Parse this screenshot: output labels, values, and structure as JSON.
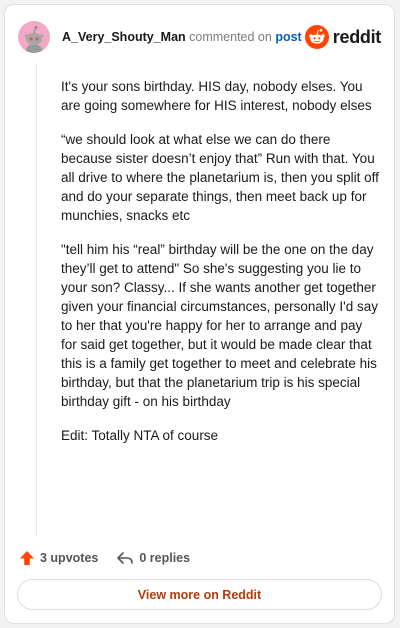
{
  "comment": {
    "username": "A_Very_Shouty_Man",
    "action_text": "commented on",
    "post_link": "post",
    "paragraphs": [
      "It's your sons birthday. HIS day, nobody elses. You are going somewhere for HIS interest, nobody elses",
      "“we should look at what else we can do there because sister doesn’t enjoy that” Run with that. You all drive to where the planetarium is, then you split off and do your separate things, then meet back up for munchies, snacks etc",
      "\"tell him his “real” birthday will be the one on the day they’ll get to attend\" So she's suggesting you lie to your son? Classy... If she wants another get together given your financial circumstances, personally I'd say to her that you're happy for her to arrange and pay for said get together, but it would be made clear that this is a family get together to meet and celebrate his birthday, but that the planetarium trip is his special birthday gift - on his birthday",
      "Edit: Totally NTA of course"
    ],
    "upvotes_label": "3 upvotes",
    "replies_label": "0 replies"
  },
  "brand": {
    "wordmark": "reddit",
    "icon": "reddit-logo-icon",
    "color": "#ff4500"
  },
  "footer": {
    "view_more_label": "View more on Reddit"
  },
  "colors": {
    "upvote": "#ff4500",
    "link": "#0b5fb5",
    "cta_text": "#b43b0a",
    "avatar_bg": "#f3a9c6"
  }
}
